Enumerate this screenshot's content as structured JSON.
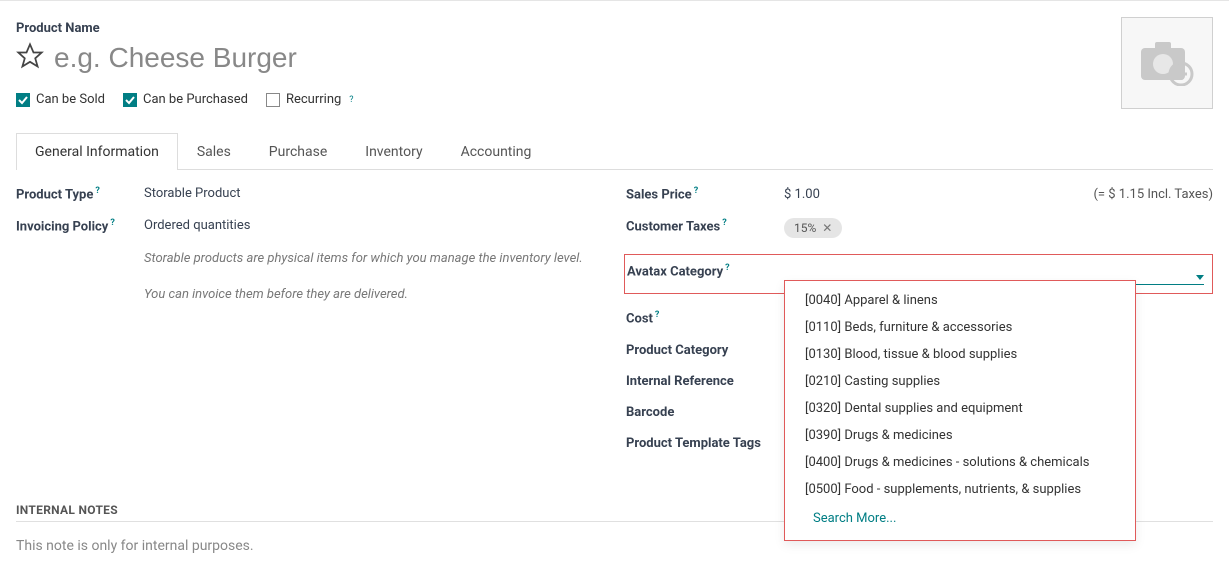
{
  "header": {
    "label": "Product Name",
    "placeholder": "e.g. Cheese Burger"
  },
  "flags": {
    "can_be_sold": "Can be Sold",
    "can_be_purchased": "Can be Purchased",
    "recurring": "Recurring"
  },
  "tabs": {
    "general": "General Information",
    "sales": "Sales",
    "purchase": "Purchase",
    "inventory": "Inventory",
    "accounting": "Accounting"
  },
  "left": {
    "product_type_label": "Product Type",
    "product_type_value": "Storable Product",
    "invoicing_policy_label": "Invoicing Policy",
    "invoicing_policy_value": "Ordered quantities",
    "help1": "Storable products are physical items for which you manage the inventory level.",
    "help2": "You can invoice them before they are delivered."
  },
  "right": {
    "sales_price_label": "Sales Price",
    "sales_price_value": "$ 1.00",
    "incl_taxes": "(= $ 1.15 Incl. Taxes)",
    "customer_taxes_label": "Customer Taxes",
    "tax_tag": "15%",
    "avatax_label": "Avatax Category",
    "cost_label": "Cost",
    "product_category_label": "Product Category",
    "internal_reference_label": "Internal Reference",
    "barcode_label": "Barcode",
    "template_tags_label": "Product Template Tags"
  },
  "dropdown": {
    "opt0": "[0040] Apparel & linens",
    "opt1": "[0110] Beds, furniture & accessories",
    "opt2": "[0130] Blood, tissue & blood supplies",
    "opt3": "[0210] Casting supplies",
    "opt4": "[0320] Dental supplies and equipment",
    "opt5": "[0390] Drugs & medicines",
    "opt6": "[0400] Drugs & medicines - solutions & chemicals",
    "opt7": "[0500] Food - supplements, nutrients, & supplies",
    "search_more": "Search More..."
  },
  "internal_notes": {
    "title": "INTERNAL NOTES",
    "placeholder": "This note is only for internal purposes."
  }
}
